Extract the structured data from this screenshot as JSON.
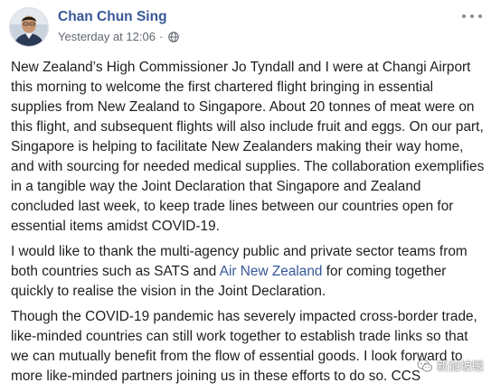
{
  "post": {
    "author": "Chan Chun Sing",
    "timestamp": "Yesterday at 12:06",
    "separator": "·",
    "privacy_icon": "globe-icon",
    "menu_icon": "more-options-icon",
    "paragraphs": [
      "New Zealand’s High Commissioner Jo Tyndall and I were at Changi Airport this morning to welcome the first chartered flight bringing in essential supplies from New Zealand to Singapore. About 20 tonnes of meat were on this flight, and subsequent flights will also include fruit and eggs. On our part, Singapore is helping to facilitate New Zealanders making their way home, and with sourcing for needed medical supplies. The collaboration exemplifies in a tangible way the Joint Declaration that Singapore and Zealand concluded last week, to keep trade lines between our countries open for essential items amidst COVID-19.",
      "Though the COVID-19 pandemic has severely impacted cross-border trade, like-minded countries can still work together to establish trade links so that we can mutually benefit from the flow of essential goods. I look forward to more like-minded partners joining us in these efforts to do so. CCS"
    ],
    "thanks_paragraph": {
      "before": "I would like to thank the multi-agency public and private sector teams from both countries such as SATS and ",
      "link": "Air New Zealand",
      "after": " for coming together quickly to realise the vision in the Joint Declaration."
    }
  },
  "watermark": {
    "text": "新加坡眼",
    "icon": "wechat-icon"
  },
  "colors": {
    "author": "#385898",
    "link": "#385898",
    "text": "#1c1e21",
    "meta": "#616770"
  }
}
